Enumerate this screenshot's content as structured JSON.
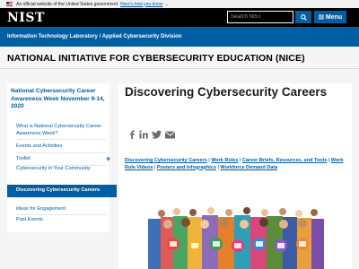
{
  "gov_banner": {
    "text": "An official website of the United States government",
    "link": "Here's how you know",
    "chevron": "chevron-down-icon"
  },
  "header": {
    "logo": "NIST",
    "search_placeholder": "Search NIST",
    "search_icon": "search-icon",
    "menu_label": "Menu",
    "menu_icon": "hamburger-icon"
  },
  "breadcrumb": {
    "items": [
      "Information Technology Laboratory",
      "Applied Cybersecurity Division"
    ],
    "separator": "/"
  },
  "page_title": "NATIONAL INITIATIVE FOR CYBERSECURITY EDUCATION (NICE)",
  "sidebar": {
    "title": "National Cybersecurity Career Awareness Week November 9-14, 2020",
    "items": [
      {
        "label": "What is National Cybersecurity Career Awareness Week?"
      },
      {
        "label": "Events and Activities"
      },
      {
        "label": "Toolkit",
        "expandable": true
      },
      {
        "label": "Cybersecurity in Your Community"
      },
      {
        "label": "Discovering Cybersecurity Careers",
        "active": true
      },
      {
        "label": "Ideas for Engagement"
      },
      {
        "label": "Past Events"
      }
    ]
  },
  "main": {
    "title": "Discovering Cybersecurity Careers",
    "share_icons": [
      "facebook-icon",
      "linkedin-icon",
      "twitter-icon",
      "email-icon"
    ],
    "links": [
      "Discovering Cybersecurity Careers",
      "Work Roles",
      "Career Briefs, Resources, and Tools",
      "Work Role Videos",
      "Posters and Infographics",
      "Workforce Demand Data"
    ],
    "link_separator": "|"
  },
  "colors": {
    "brand_blue": "#005ea2",
    "header_black": "#000000",
    "band_gray": "#f5f5f5"
  }
}
